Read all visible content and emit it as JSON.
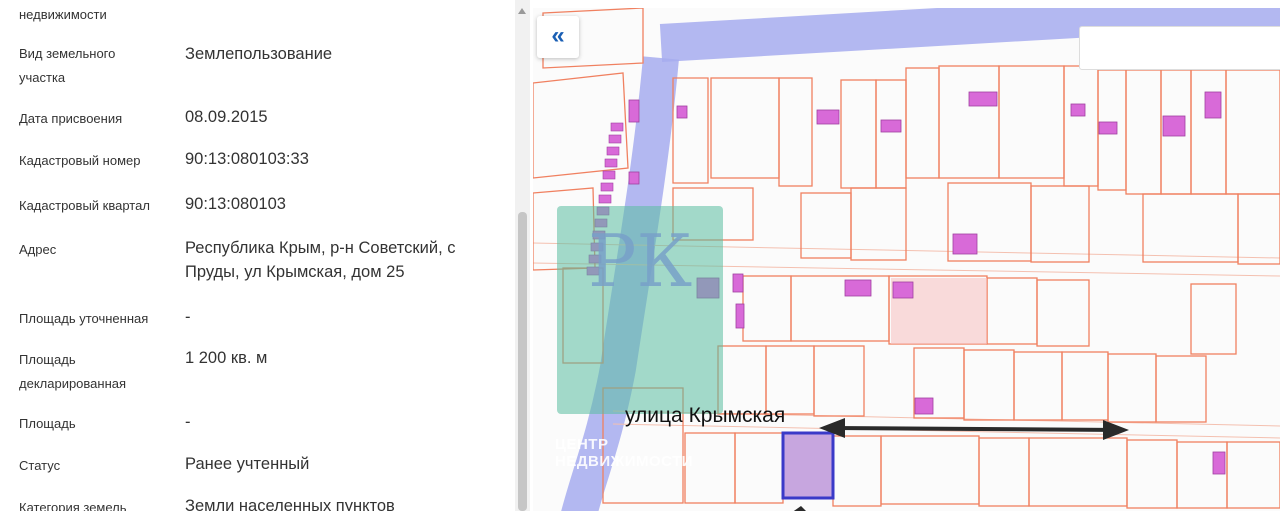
{
  "panel": {
    "rows": [
      {
        "label": "недвижимости",
        "value": ""
      },
      {
        "label": "Вид земельного участка",
        "value": "Землепользование"
      },
      {
        "label": "Дата присвоения",
        "value": "08.09.2015"
      },
      {
        "label": "Кадастровый номер",
        "value": "90:13:080103:33"
      },
      {
        "label": "Кадастровый квартал",
        "value": "90:13:080103"
      },
      {
        "label": "Адрес",
        "value": "Республика Крым, р-н Советский, с Пруды, ул Крымская, дом 25"
      },
      {
        "label": "Площадь уточненная",
        "value": "-"
      },
      {
        "label": "Площадь декларированная",
        "value": "1 200 кв. м"
      },
      {
        "label": "Площадь",
        "value": "-"
      },
      {
        "label": "Статус",
        "value": "Ранее учтенный"
      },
      {
        "label": "Категория земель",
        "value": "Земли населенных пунктов"
      }
    ]
  },
  "map": {
    "collapse_icon": "«",
    "street_label": "улица Крымская",
    "watermark": {
      "letters": "РК",
      "line1": "ЦЕНТР",
      "line2": "НЕДВИЖИМОСТИ"
    },
    "colors": {
      "parcel_line": "#f08060",
      "road": "#9fa6ec",
      "building": "#d86ad8",
      "selected": "#3a3ac8"
    }
  }
}
